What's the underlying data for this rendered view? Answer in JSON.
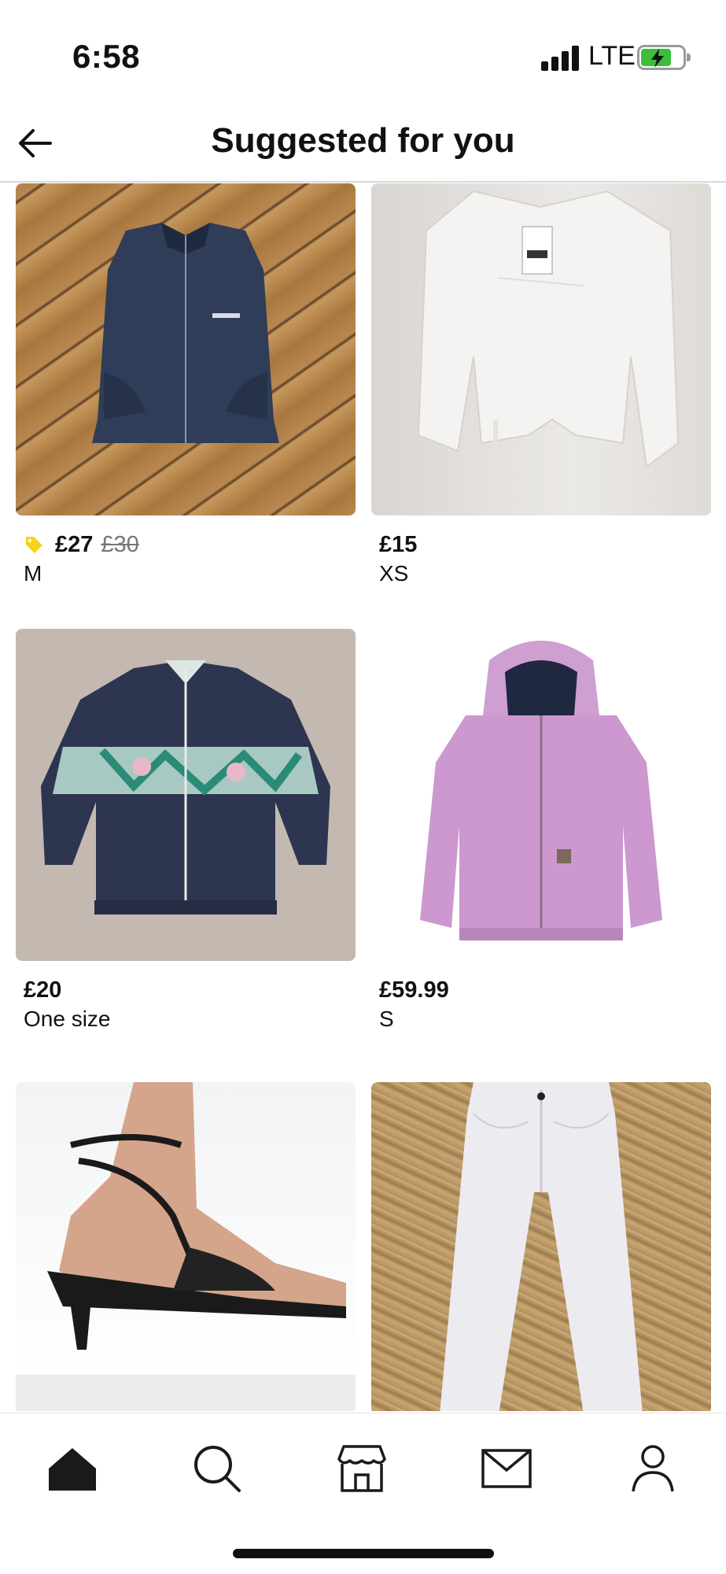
{
  "status_bar": {
    "time": "6:58",
    "network": "LTE"
  },
  "header": {
    "title": "Suggested for you",
    "back_icon": "arrow-left-icon"
  },
  "colors": {
    "sale_tag": "#f5d31a",
    "text": "#111111",
    "muted": "#777777"
  },
  "items": [
    {
      "price": "£27",
      "old_price": "£30",
      "size": "M",
      "on_sale": true,
      "photo": "navy zip vest on wooden floor"
    },
    {
      "price": "£15",
      "old_price": "",
      "size": "XS",
      "on_sale": false,
      "photo": "white cropped tie-front shirt on hanger"
    },
    {
      "price": "£20",
      "old_price": "",
      "size": "One size",
      "on_sale": false,
      "photo": "navy patterned track jacket"
    },
    {
      "price": "£59.99",
      "old_price": "",
      "size": "S",
      "on_sale": false,
      "photo": "pink hooded work jacket"
    },
    {
      "price": "",
      "old_price": "",
      "size": "",
      "on_sale": false,
      "photo": "black strappy heeled sandal"
    },
    {
      "price": "",
      "old_price": "",
      "size": "",
      "on_sale": false,
      "photo": "white straight-leg jeans on board"
    }
  ],
  "bottom_nav": [
    {
      "name": "home",
      "icon": "home-icon",
      "active": true
    },
    {
      "name": "search",
      "icon": "search-icon",
      "active": false
    },
    {
      "name": "shop",
      "icon": "shop-icon",
      "active": false
    },
    {
      "name": "inbox",
      "icon": "mail-icon",
      "active": false
    },
    {
      "name": "profile",
      "icon": "profile-icon",
      "active": false
    }
  ]
}
